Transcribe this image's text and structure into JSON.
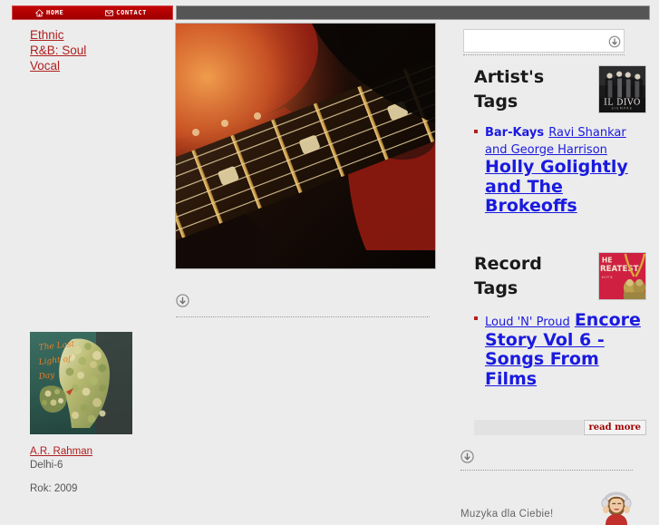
{
  "nav": {
    "home_label": "Home",
    "home_icon": "house-icon",
    "contact_label": "Contact",
    "contact_icon": "envelope-icon"
  },
  "sidebar": {
    "categories": [
      {
        "label": "Ethnic"
      },
      {
        "label": "R&B: Soul"
      },
      {
        "label": "Vocal"
      }
    ],
    "album": {
      "cover_alt": "The Last Light of Day",
      "cover_text_line1": "The Last",
      "cover_text_line2": "Light of",
      "cover_text_line3": "Day",
      "artist": "A.R. Rahman",
      "title": "Delhi-6",
      "year": "Rok: 2009"
    }
  },
  "main": {
    "hero_alt": "electric-guitar-fretboard",
    "scroll_icon": "arrow-down-circle-icon"
  },
  "search": {
    "value": "",
    "placeholder": "",
    "submit_icon": "arrow-down-circle-icon"
  },
  "artist_tags": {
    "title": "Artist's Tags",
    "thumb_alt": "IL DIVO",
    "thumb_caption": "IL DIVO",
    "tags": [
      {
        "label": "Bar-Kays",
        "size": "s1"
      },
      {
        "label": "Ravi Shankar and George Harrison",
        "size": "s2"
      },
      {
        "label": "Holly Golightly and The Brokeoffs",
        "size": "s3"
      }
    ]
  },
  "record_tags": {
    "title": "Record Tags",
    "thumb_alt": "The Greatest",
    "tags": [
      {
        "label": "Loud 'N' Proud",
        "size": "s2"
      },
      {
        "label": "Encore Story Vol 6 - Songs From Films",
        "size": "s3"
      }
    ]
  },
  "read_more": {
    "label": "read more"
  },
  "promo": {
    "text": "Muzyka dla Ciebie!",
    "image_alt": "woman-with-headphones",
    "scroll_icon": "arrow-down-circle-icon"
  },
  "colors": {
    "nav_red": "#b40000",
    "link_red": "#b02020",
    "tag_blue": "#1a1ae0",
    "page_bg": "#ececec",
    "gray_bar": "#555555"
  }
}
